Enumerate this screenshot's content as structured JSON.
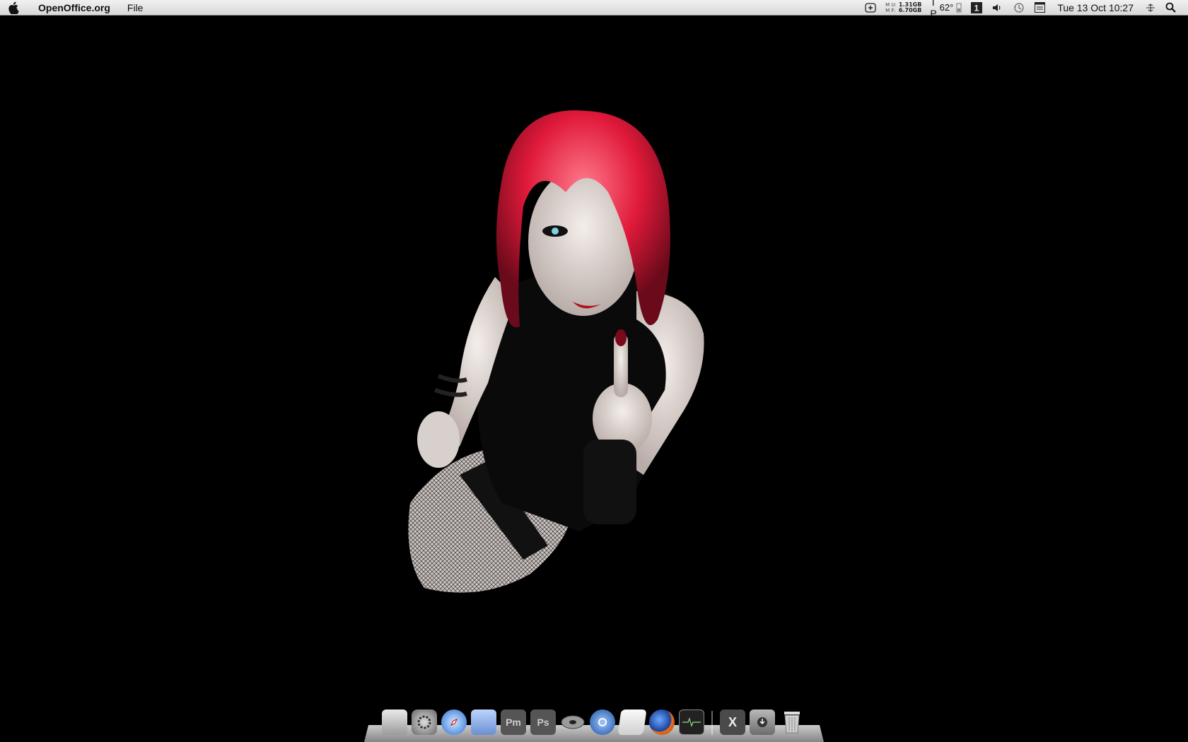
{
  "menubar": {
    "app_name": "OpenOffice.org",
    "menus": [
      "File"
    ],
    "memory": {
      "labels_top": "M U:",
      "labels_bottom": "M F:",
      "used": "1.31GB",
      "free": "6.70GB"
    },
    "cpu_label_top": "T",
    "cpu_label_bottom": "P",
    "temperature": "62°",
    "clock": "Tue 13 Oct  10:27"
  },
  "icons": {
    "apple": "apple-icon",
    "add": "add-square-icon",
    "spaces": "spaces-icon",
    "volume": "volume-icon",
    "time_machine": "time-machine-icon",
    "calendar": "calendar-icon",
    "bluetooth": "bluetooth-icon",
    "spotlight": "spotlight-search-icon"
  },
  "dock": {
    "items": [
      {
        "name": "finder-icon",
        "label": ""
      },
      {
        "name": "system-preferences-icon",
        "label": ""
      },
      {
        "name": "safari-icon",
        "label": ""
      },
      {
        "name": "mail-icon",
        "label": ""
      },
      {
        "name": "photoshop-elements-icon",
        "label": "Pm"
      },
      {
        "name": "photoshop-icon",
        "label": "Ps"
      },
      {
        "name": "dvd-icon",
        "label": ""
      },
      {
        "name": "quicktime-icon",
        "label": ""
      },
      {
        "name": "textedit-icon",
        "label": ""
      },
      {
        "name": "firefox-icon",
        "label": ""
      },
      {
        "name": "activity-monitor-icon",
        "label": ""
      },
      {
        "name": "x11-icon",
        "label": "X"
      },
      {
        "name": "downloads-icon",
        "label": ""
      },
      {
        "name": "trash-icon",
        "label": ""
      }
    ]
  },
  "colors": {
    "hair": "#e0193a",
    "background": "#000000"
  }
}
